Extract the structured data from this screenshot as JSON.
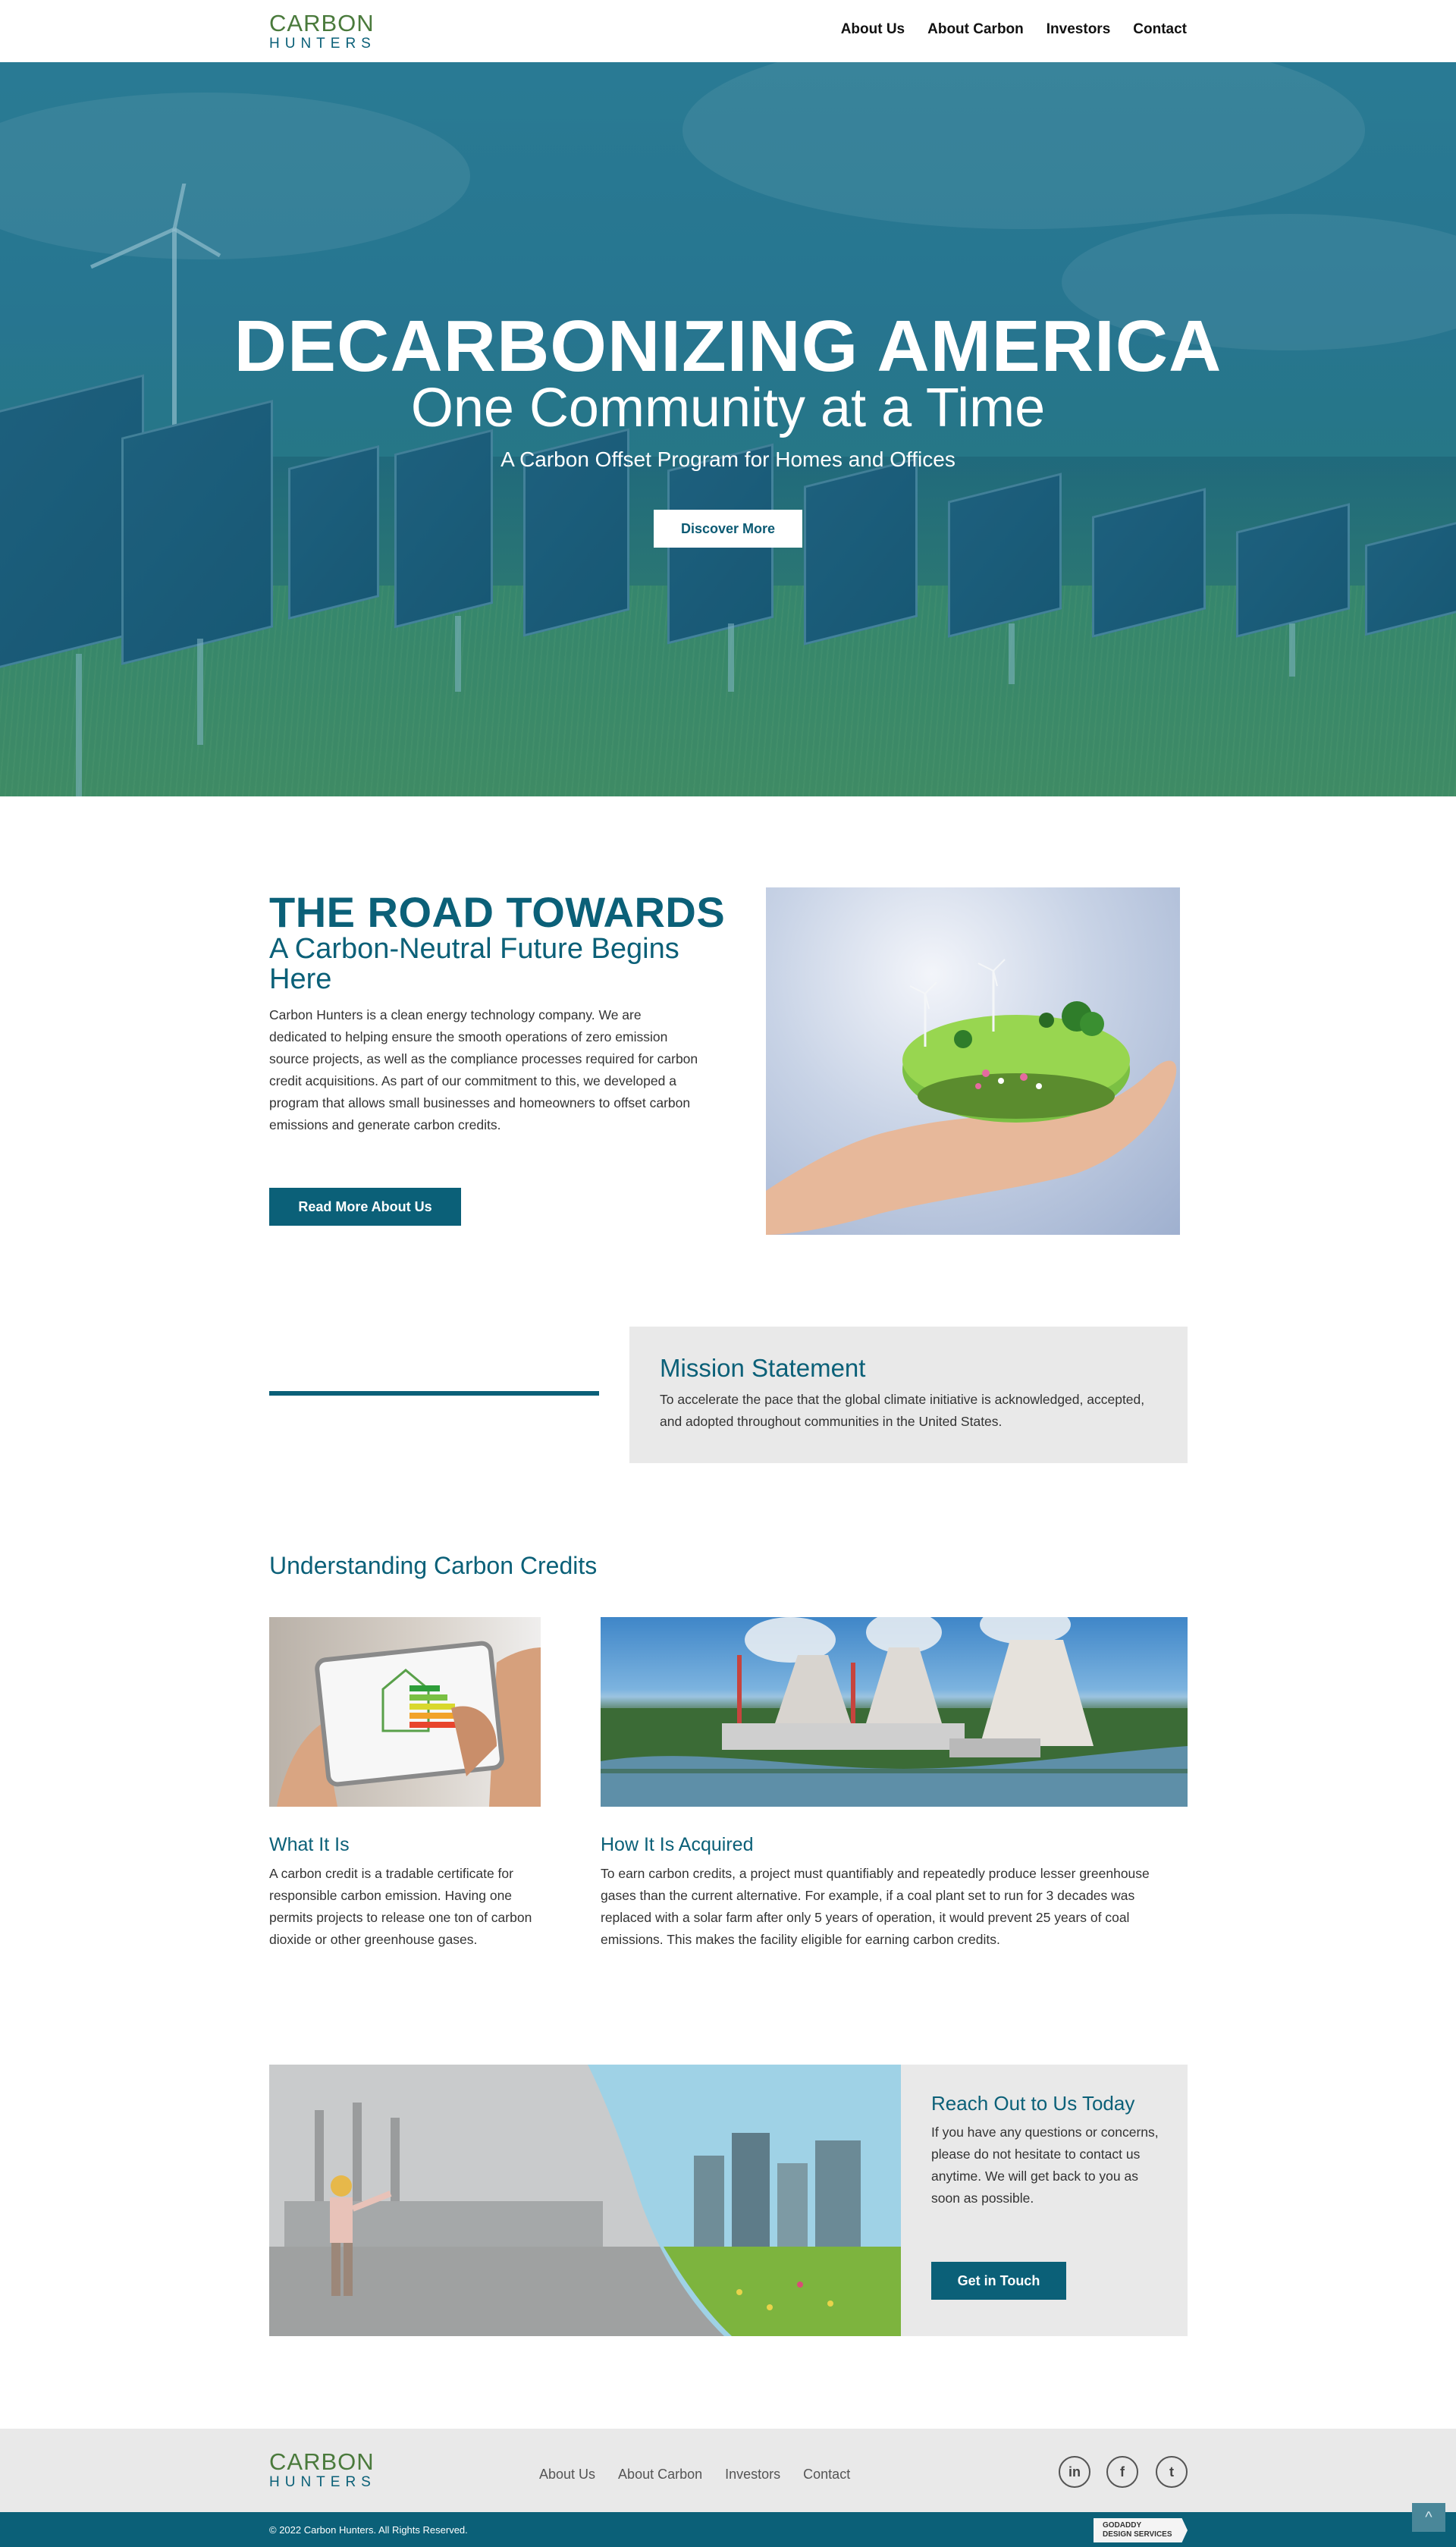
{
  "brand": {
    "line1": "CARBON",
    "line2": "HUNTERS"
  },
  "nav": [
    "About Us",
    "About Carbon",
    "Investors",
    "Contact"
  ],
  "hero": {
    "title": "DECARBONIZING AMERICA",
    "subtitle": "One Community at a Time",
    "tagline": "A Carbon Offset Program for Homes and Offices",
    "button": "Discover More"
  },
  "road": {
    "title": "THE ROAD TOWARDS",
    "subtitle": "A Carbon-Neutral Future Begins Here",
    "body": "Carbon Hunters is a clean energy technology company. We are dedicated to helping ensure the smooth operations of zero emission source projects, as well as the compliance processes required for carbon credit acquisitions. As part of our commitment to this, we developed a program that allows small businesses and homeowners to offset carbon emissions and generate carbon credits.",
    "button": "Read More About Us"
  },
  "mission": {
    "title": "Mission Statement",
    "body": "To accelerate the pace that the global climate initiative is acknowledged, accepted, and adopted throughout communities in the United States."
  },
  "credits": {
    "title": "Understanding Carbon Credits",
    "what": {
      "title": "What It Is",
      "body": "A carbon credit is a tradable certificate for responsible carbon emission. Having one permits projects to release one ton of carbon dioxide or other greenhouse gases."
    },
    "how": {
      "title": "How It Is Acquired",
      "body": "To earn carbon credits, a project must quantifiably and repeatedly produce lesser greenhouse gases than the current alternative. For example, if a coal plant set to run for 3 decades was replaced with a solar farm after only 5 years of operation, it would prevent 25 years of coal emissions. This makes the facility eligible for earning carbon credits."
    }
  },
  "reach": {
    "title": "Reach Out to Us Today",
    "body": "If you have any questions or concerns, please do not hesitate to contact us anytime. We will get back to you as soon as possible.",
    "button": "Get in Touch"
  },
  "footer": {
    "nav": [
      "About Us",
      "About Carbon",
      "Investors",
      "Contact"
    ],
    "social": [
      {
        "icon": "linkedin-icon",
        "glyph": "in"
      },
      {
        "icon": "facebook-icon",
        "glyph": "f"
      },
      {
        "icon": "twitter-icon",
        "glyph": "t"
      }
    ],
    "copyright": "© 2022 Carbon Hunters. All Rights Reserved.",
    "badge": {
      "line1": "GODADDY",
      "line2": "DESIGN SERVICES"
    },
    "to_top": "^"
  },
  "colors": {
    "brand_teal": "#0b6078",
    "brand_green": "#4a7a3c",
    "panel_gray": "#e9e9e9"
  }
}
